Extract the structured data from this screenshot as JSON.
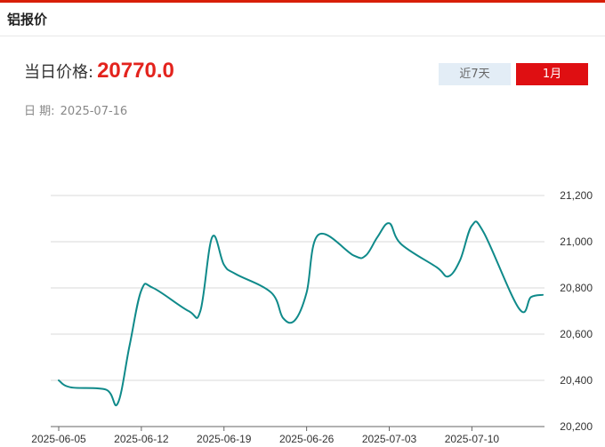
{
  "header": {
    "title": "铝报价"
  },
  "price": {
    "label": "当日价格:",
    "value": "20770.0"
  },
  "date": {
    "label": "日 期:",
    "value": "2025-07-16"
  },
  "range_tabs": [
    {
      "label": "近7天",
      "active": false
    },
    {
      "label": "1月",
      "active": true
    }
  ],
  "colors": {
    "accent": "#df0f12",
    "line": "#0f8a8a",
    "tab_inactive_bg": "#e3edf6"
  },
  "chart_data": {
    "type": "line",
    "title": "",
    "xlabel": "",
    "ylabel": "",
    "ylim": [
      20200,
      21200
    ],
    "yticks": [
      20200,
      20400,
      20600,
      20800,
      21000,
      21200
    ],
    "ytick_labels": [
      "20,200",
      "20,400",
      "20,600",
      "20,800",
      "21,000",
      "21,200"
    ],
    "xtick_labels": [
      "2025-06-05",
      "2025-06-12",
      "2025-06-19",
      "2025-06-26",
      "2025-07-03",
      "2025-07-10"
    ],
    "grid": true,
    "x": [
      "2025-06-05",
      "2025-06-06",
      "2025-06-09",
      "2025-06-10",
      "2025-06-11",
      "2025-06-12",
      "2025-06-13",
      "2025-06-16",
      "2025-06-17",
      "2025-06-18",
      "2025-06-19",
      "2025-06-20",
      "2025-06-23",
      "2025-06-24",
      "2025-06-25",
      "2025-06-26",
      "2025-06-27",
      "2025-06-30",
      "2025-07-01",
      "2025-07-02",
      "2025-07-03",
      "2025-07-04",
      "2025-07-07",
      "2025-07-08",
      "2025-07-09",
      "2025-07-10",
      "2025-07-11",
      "2025-07-14",
      "2025-07-15",
      "2025-07-16"
    ],
    "series": [
      {
        "values": [
          20400,
          20370,
          20360,
          20300,
          20550,
          20790,
          20800,
          20700,
          20700,
          21020,
          20900,
          20860,
          20780,
          20670,
          20660,
          20780,
          21030,
          20940,
          20940,
          21020,
          21080,
          20990,
          20890,
          20850,
          20920,
          21070,
          21040,
          20710,
          20760,
          20770
        ]
      }
    ]
  }
}
